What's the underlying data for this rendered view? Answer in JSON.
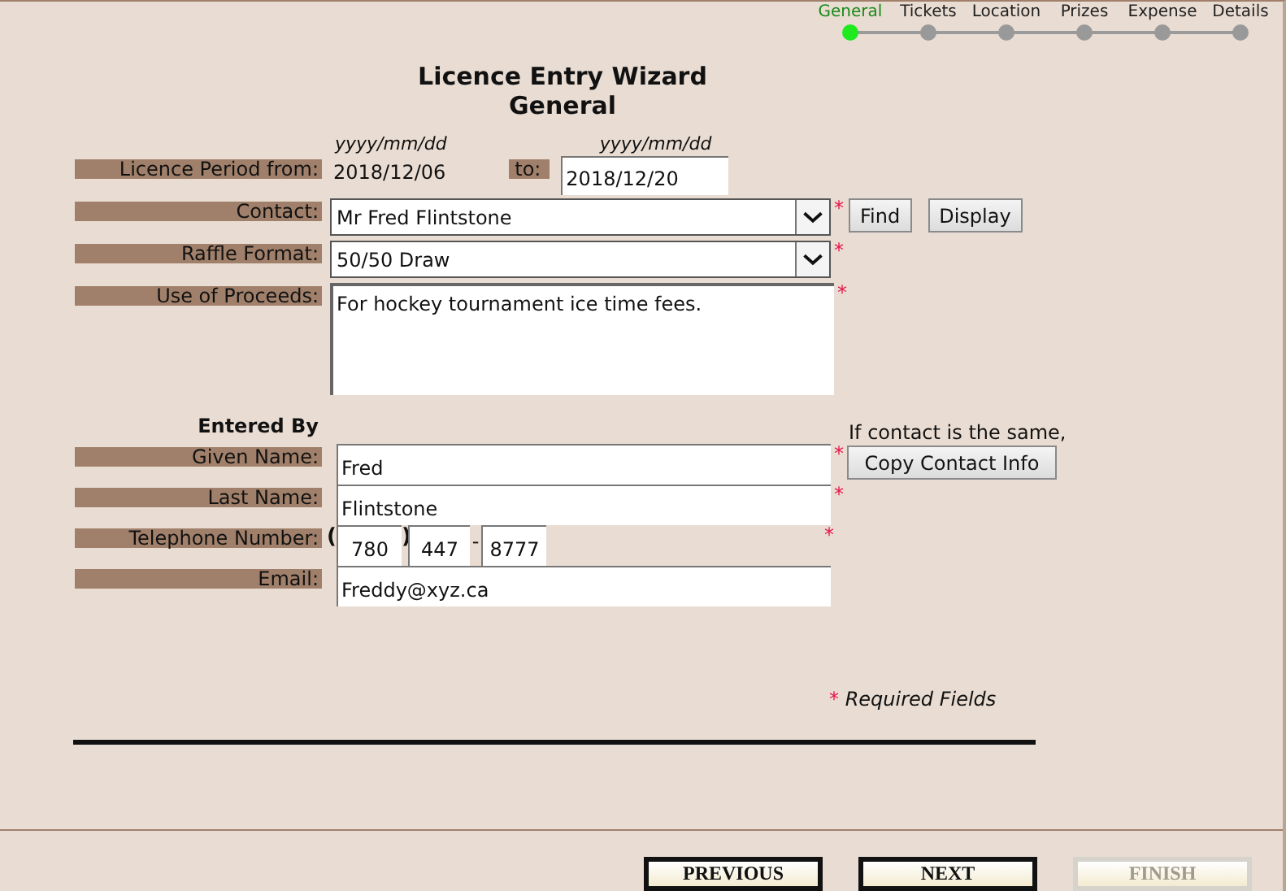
{
  "steps": [
    {
      "label": "General",
      "selected": true
    },
    {
      "label": "Tickets",
      "selected": false
    },
    {
      "label": "Location",
      "selected": false
    },
    {
      "label": "Prizes",
      "selected": false
    },
    {
      "label": "Expense",
      "selected": false
    },
    {
      "label": "Details",
      "selected": false
    }
  ],
  "title": "Licence Entry Wizard",
  "subtitle": "General",
  "licence_period": {
    "from_hint": "yyyy/mm/dd",
    "to_hint": "yyyy/mm/dd",
    "label": "Licence Period from:",
    "from_value": "2018/12/06",
    "to_label": "to:",
    "to_value": "2018/12/20"
  },
  "details": [
    {
      "kind": "select",
      "label": "Contact:",
      "value": "Mr Fred Flintstone",
      "required_mark": "*",
      "buttons": [
        "Find",
        "Display"
      ]
    },
    {
      "kind": "select",
      "label": "Raffle Format:",
      "value": "50/50 Draw",
      "required_mark": "*"
    },
    {
      "kind": "textarea",
      "label": "Use of Proceeds:",
      "value": "For hockey tournament ice time fees.",
      "required_mark": "*"
    }
  ],
  "entered_by": {
    "heading": "Entered By",
    "note": "If contact is the same,",
    "copy_button": "Copy Contact Info",
    "fields": [
      {
        "kind": "text",
        "label": "Given Name:",
        "value": "Fred",
        "required_mark": "*"
      },
      {
        "kind": "text",
        "label": "Last Name:",
        "value": "Flintstone",
        "required_mark": "*"
      },
      {
        "kind": "phone",
        "label": "Telephone Number:",
        "open": "(",
        "close": ")",
        "separator": "-",
        "values": [
          "780",
          "447",
          "8777"
        ],
        "required_mark": "*"
      },
      {
        "kind": "text",
        "label": "Email:",
        "value": "Freddy@xyz.ca"
      }
    ]
  },
  "required_note": {
    "mark": "*",
    "text": "Required Fields"
  },
  "nav": [
    {
      "label": "PREVIOUS",
      "disabled": false
    },
    {
      "label": "NEXT",
      "disabled": false
    },
    {
      "label": "FINISH",
      "disabled": true
    }
  ]
}
